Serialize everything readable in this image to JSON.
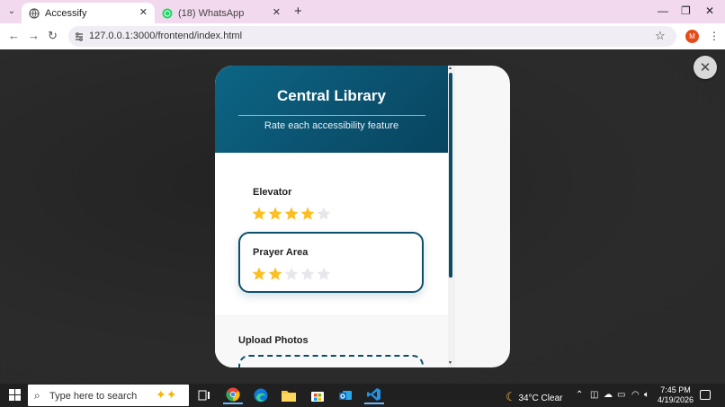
{
  "browser": {
    "tabs": [
      {
        "title": "Accessify",
        "active": true
      },
      {
        "title": "(18) WhatsApp",
        "active": false
      }
    ],
    "url": "127.0.0.1:3000/frontend/index.html",
    "profile_initial": "M"
  },
  "modal": {
    "title": "Central Library",
    "subtitle": "Rate each accessibility feature",
    "features": [
      {
        "name": "Elevator",
        "rating": 4,
        "max": 5,
        "selected": false
      },
      {
        "name": "Prayer Area",
        "rating": 2,
        "max": 5,
        "selected": true
      }
    ],
    "upload_title": "Upload Photos",
    "close_label": "✕"
  },
  "taskbar": {
    "search_placeholder": "Type here to search",
    "weather": "34°C  Clear",
    "time": "7:45 PM",
    "date": "4/19/2026"
  },
  "colors": {
    "accent": "#0c4f6b",
    "star_filled": "#fbbf24",
    "star_empty": "#e5e7eb"
  }
}
